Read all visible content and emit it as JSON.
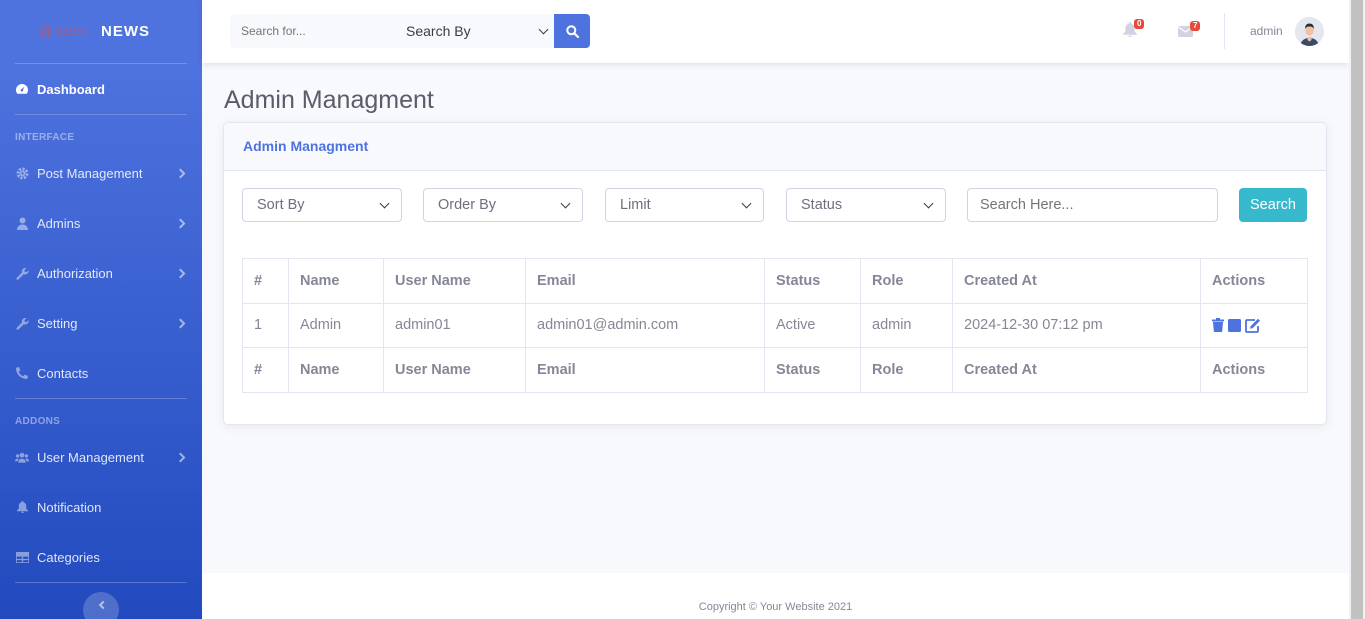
{
  "brand": {
    "logo_text": "NEWS",
    "name": "NEWS"
  },
  "sidebar": {
    "dashboard": "Dashboard",
    "heading_interface": "INTERFACE",
    "items_interface": [
      {
        "label": "Post Management",
        "icon": "gear-icon",
        "has_children": true
      },
      {
        "label": "Admins",
        "icon": "user-icon",
        "has_children": true
      },
      {
        "label": "Authorization",
        "icon": "wrench-icon",
        "has_children": true
      },
      {
        "label": "Setting",
        "icon": "wrench-icon",
        "has_children": true
      },
      {
        "label": "Contacts",
        "icon": "phone-icon",
        "has_children": false
      }
    ],
    "heading_addons": "ADDONS",
    "items_addons": [
      {
        "label": "User Management",
        "icon": "users-icon",
        "has_children": true
      },
      {
        "label": "Notification",
        "icon": "bell-icon",
        "has_children": false
      },
      {
        "label": "Categories",
        "icon": "table-icon",
        "has_children": false
      }
    ]
  },
  "topbar": {
    "search_placeholder": "Search for...",
    "search_by": "Search By",
    "alerts_count": "0",
    "messages_count": "7",
    "username": "admin"
  },
  "page": {
    "title": "Admin Managment",
    "card_title": "Admin Managment",
    "filters": {
      "sort_by": "Sort By",
      "order_by": "Order By",
      "limit": "Limit",
      "status": "Status",
      "search_placeholder": "Search Here...",
      "search_button": "Search"
    }
  },
  "table": {
    "headers": [
      "#",
      "Name",
      "User Name",
      "Email",
      "Status",
      "Role",
      "Created At",
      "Actions"
    ],
    "rows": [
      [
        "1",
        "Admin",
        "admin01",
        "admin01@admin.com",
        "Active",
        "admin",
        "2024-12-30 07:12 pm"
      ]
    ]
  },
  "footer": {
    "copyright": "Copyright © Your Website 2021"
  },
  "colors": {
    "primary": "#4e73df",
    "info": "#36b9cc",
    "danger": "#e74a3b"
  }
}
